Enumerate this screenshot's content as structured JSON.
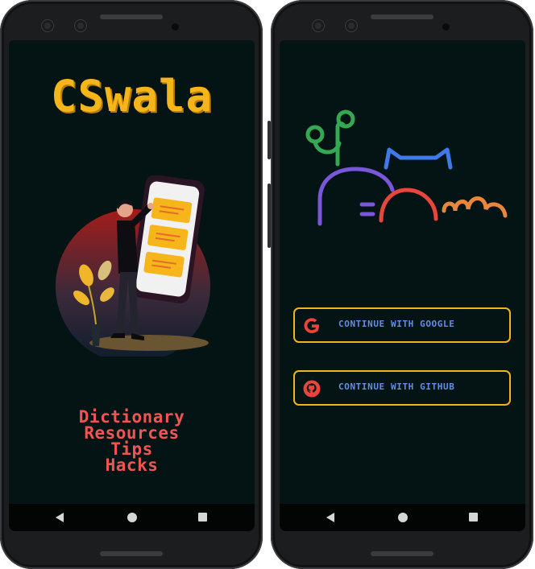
{
  "left_screen": {
    "app_title": "CSwala",
    "features": [
      "Dictionary",
      "Resources",
      "Tips",
      "Hacks"
    ]
  },
  "right_screen": {
    "auth_buttons": {
      "google_label": "CONTINUE WITH GOOGLE",
      "github_label": "CONTINUE WITH GITHUB"
    }
  },
  "icons": {
    "google": "google-g-icon",
    "github": "github-octocat-icon",
    "nav_back": "back-triangle-icon",
    "nav_home": "home-circle-icon",
    "nav_recents": "recents-square-icon"
  },
  "colors": {
    "screen_background": "#041313",
    "title_yellow": "#f6b51a",
    "feature_red": "#f05553",
    "button_border": "#f3b31c",
    "button_text": "#5f8fe9",
    "google_red": "#e8453c",
    "github_red": "#e8453c",
    "art_green": "#35a853",
    "art_blue": "#3f7be8",
    "art_purple": "#7a56d9",
    "art_red": "#e8453c",
    "art_orange": "#e8873c"
  }
}
